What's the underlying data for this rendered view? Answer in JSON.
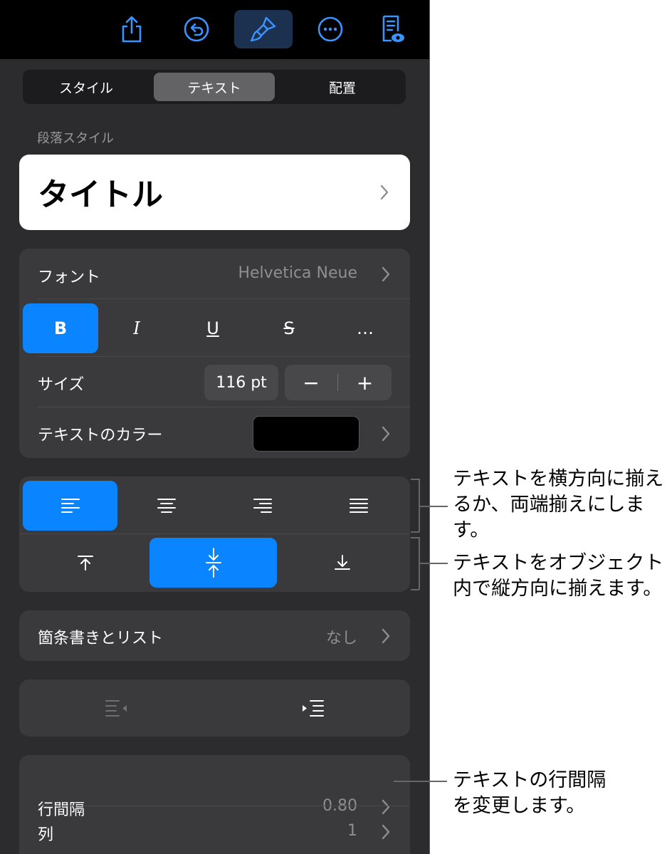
{
  "toolbar": {
    "icons": [
      "share-icon",
      "undo-icon",
      "paintbrush-icon",
      "more-icon",
      "reader-view-icon"
    ],
    "active": "paintbrush-icon"
  },
  "tabs": {
    "style": "スタイル",
    "text": "テキスト",
    "arrange": "配置",
    "active": "text"
  },
  "paragraph_style": {
    "section_label": "段落スタイル",
    "value": "タイトル"
  },
  "font": {
    "label": "フォント",
    "value": "Helvetica Neue",
    "bold": "B",
    "italic": "I",
    "underline": "U",
    "strike": "S",
    "more": "…",
    "bold_active": true
  },
  "size": {
    "label": "サイズ",
    "value": "116 pt",
    "minus": "−",
    "plus": "+"
  },
  "color": {
    "label": "テキストのカラー",
    "swatch": "#000000"
  },
  "alignment": {
    "horizontal": [
      "left",
      "center",
      "right",
      "justify"
    ],
    "horizontal_active": "left",
    "vertical": [
      "top",
      "middle",
      "bottom"
    ],
    "vertical_active": "middle"
  },
  "bullets": {
    "label": "箇条書きとリスト",
    "value": "なし"
  },
  "line_spacing": {
    "label": "行間隔",
    "value": "0.80"
  },
  "columns": {
    "label": "列",
    "value": "1"
  },
  "callouts": {
    "horizontal_line1": "テキストを横方向に揃え",
    "horizontal_line2": "るか、両端揃えにします。",
    "vertical_line1": "テキストをオブジェクト",
    "vertical_line2": "内で縦方向に揃えます。",
    "spacing_line1": "テキストの行間隔",
    "spacing_line2": "を変更します。"
  },
  "colors": {
    "accent": "#0a84ff",
    "panel": "#2c2c2e",
    "group": "#3a3a3c"
  }
}
